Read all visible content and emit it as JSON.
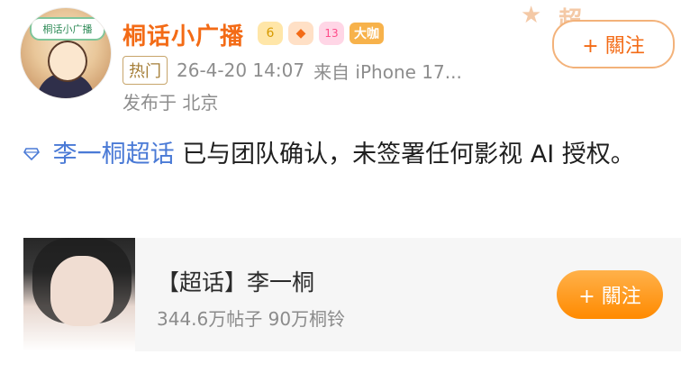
{
  "header": {
    "username": "桐话小广播",
    "level_badges": [
      "crown-badge",
      "fish-badge",
      "diamond-13-badge"
    ],
    "crown_badge_text": "6",
    "diamond_badge_text": "13",
    "vip_label": "大咖",
    "hot_label": "热门",
    "timestamp": "26-4-20 14:07",
    "source": "来自 iPhone 17...",
    "location": "发布于 北京",
    "follow_label": "+ 關注"
  },
  "avatar": {
    "badge_text": "桐话小广播"
  },
  "post": {
    "topic": "李一桐超话",
    "text": " 已与团队确认，未签署任何影视 AI 授权。"
  },
  "card": {
    "title": "【超话】李一桐",
    "stats": "344.6万帖子 90万桐铃",
    "follow_label": "+ 關注"
  },
  "colors": {
    "accent": "#f36b16",
    "link": "#4a7ad6",
    "text": "#1f1f1f"
  }
}
